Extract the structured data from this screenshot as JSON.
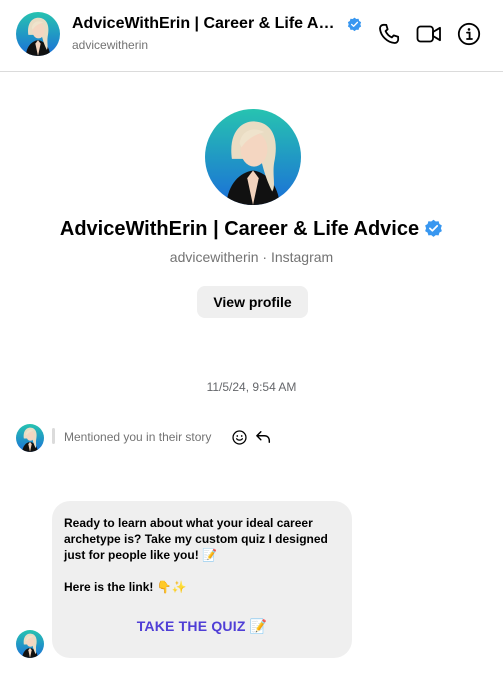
{
  "header": {
    "name": "AdviceWithErin | Career & Life Advice",
    "username": "advicewitherin"
  },
  "profile": {
    "name": "AdviceWithErin | Career & Life Advice",
    "subtitle": "advicewitherin · Instagram",
    "view_profile_label": "View profile"
  },
  "thread": {
    "timestamp": "11/5/24, 9:54 AM",
    "mention_text": "Mentioned you in their story",
    "message_text": "Ready to learn about what your ideal career archetype is? Take my custom quiz I designed just for people like you! 📝\n\nHere is the link! 👇✨",
    "link_text": "TAKE THE QUIZ 📝"
  },
  "colors": {
    "verified": "#3897f0",
    "link": "#4f3ed6",
    "avatar_bg_top": "#1fb6c9",
    "avatar_bg_bottom": "#1a7bd6"
  },
  "icons": [
    "verified-icon",
    "phone-icon",
    "video-icon",
    "info-icon",
    "emoji-icon",
    "reply-icon"
  ]
}
